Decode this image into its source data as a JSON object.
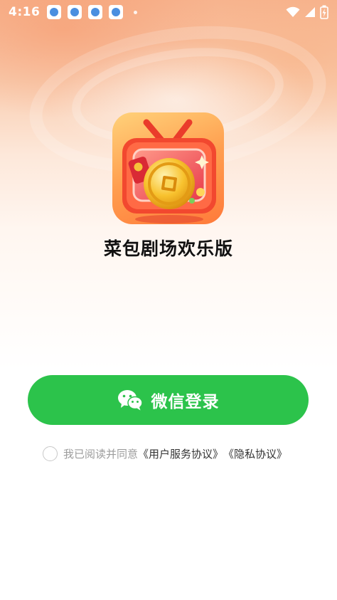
{
  "status_bar": {
    "time": "4:16",
    "notification_icons": [
      "notification-app-icon",
      "notification-app-icon",
      "notification-app-icon",
      "notification-app-icon"
    ],
    "icons": [
      "wifi-icon",
      "cellular-signal-icon",
      "battery-charging-icon"
    ]
  },
  "app": {
    "icon": "tv-coin-app-icon",
    "name": "菜包剧场欢乐版"
  },
  "login": {
    "button_label": "微信登录",
    "icon": "wechat-icon",
    "color": "#2cc34b"
  },
  "agreement": {
    "checked": false,
    "prefix": "我已阅读并同意",
    "user_agreement": "《用户服务协议》",
    "privacy_policy": "《隐私协议》"
  }
}
